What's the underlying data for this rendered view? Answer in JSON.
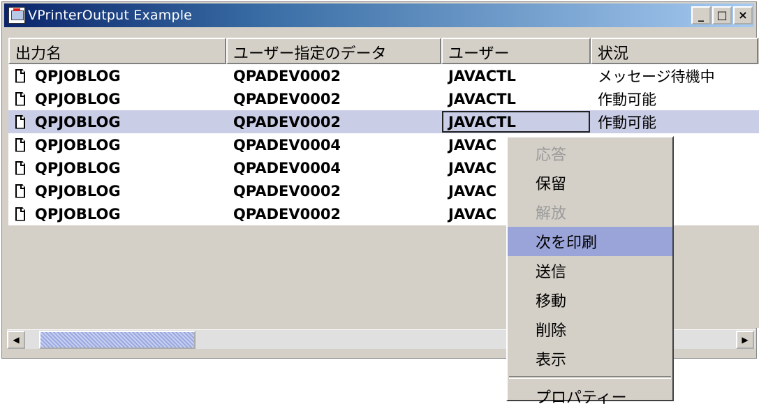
{
  "window": {
    "title": "VPrinterOutput Example",
    "controls": {
      "minimize": "_",
      "maximize": "□",
      "close": "×"
    }
  },
  "table": {
    "columns": [
      "出力名",
      "ユーザー指定のデータ",
      "ユーザー",
      "状況"
    ],
    "rows": [
      {
        "name": "QPJOBLOG",
        "data": "QPADEV0002",
        "user": "JAVACTL",
        "status": "メッセージ待機中"
      },
      {
        "name": "QPJOBLOG",
        "data": "QPADEV0002",
        "user": "JAVACTL",
        "status": "作動可能"
      },
      {
        "name": "QPJOBLOG",
        "data": "QPADEV0002",
        "user": "JAVACTL",
        "status": "作動可能"
      },
      {
        "name": "QPJOBLOG",
        "data": "QPADEV0004",
        "user": "JAVAC",
        "status": ""
      },
      {
        "name": "QPJOBLOG",
        "data": "QPADEV0004",
        "user": "JAVAC",
        "status": ""
      },
      {
        "name": "QPJOBLOG",
        "data": "QPADEV0002",
        "user": "JAVAC",
        "status": ""
      },
      {
        "name": "QPJOBLOG",
        "data": "QPADEV0002",
        "user": "JAVAC",
        "status": ""
      }
    ],
    "selected_row": 2
  },
  "context_menu": {
    "items": [
      "応答",
      "保留",
      "解放",
      "次を印刷",
      "送信",
      "移動",
      "削除",
      "表示",
      "プロパティー"
    ],
    "disabled": [
      "応答",
      "解放"
    ],
    "highlighted": "次を印刷"
  },
  "scrollbar": {
    "left_arrow": "◀",
    "right_arrow": "▶"
  },
  "colors": {
    "selection": "#c9cde6",
    "menu_highlight": "#9aa4d8",
    "title_start": "#0a246a"
  }
}
